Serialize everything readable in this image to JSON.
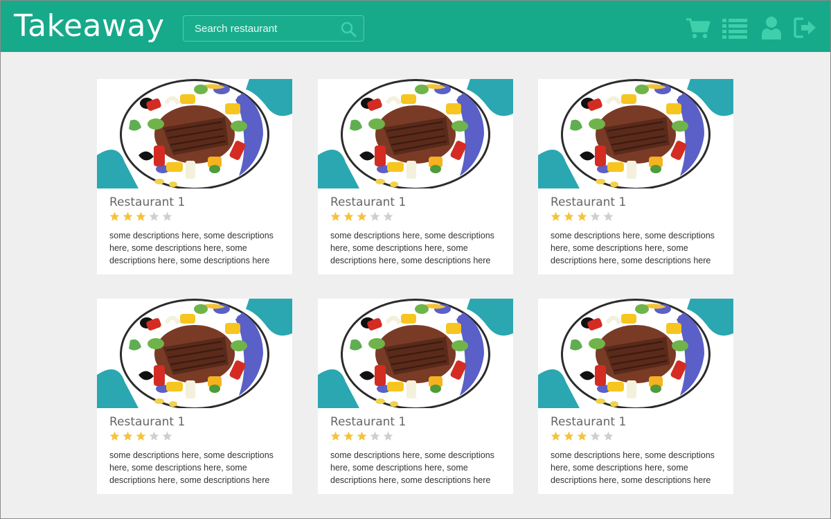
{
  "app": {
    "title": "Takeaway"
  },
  "search": {
    "placeholder": "Search restaurant"
  },
  "nav": {
    "icons": [
      "cart-icon",
      "list-icon",
      "user-icon",
      "logout-icon"
    ]
  },
  "colors": {
    "brand": "#16a98a",
    "icon": "#3fcfab",
    "star_filled": "#f5c33b",
    "star_empty": "#cfcfcf",
    "background": "#efefef"
  },
  "restaurants": [
    {
      "name": "Restaurant 1",
      "rating": 3,
      "max_rating": 5,
      "description": "some descriptions here, some descriptions here, some descriptions here, some descriptions here, some descriptions here"
    },
    {
      "name": "Restaurant 1",
      "rating": 3,
      "max_rating": 5,
      "description": "some descriptions here, some descriptions here, some descriptions here, some descriptions here, some descriptions here"
    },
    {
      "name": "Restaurant 1",
      "rating": 3,
      "max_rating": 5,
      "description": "some descriptions here, some descriptions here, some descriptions here, some descriptions here, some descriptions here"
    },
    {
      "name": "Restaurant 1",
      "rating": 3,
      "max_rating": 5,
      "description": "some descriptions here, some descriptions here, some descriptions here, some descriptions here, some descriptions here"
    },
    {
      "name": "Restaurant 1",
      "rating": 3,
      "max_rating": 5,
      "description": "some descriptions here, some descriptions here, some descriptions here, some descriptions here, some descriptions here"
    },
    {
      "name": "Restaurant 1",
      "rating": 3,
      "max_rating": 5,
      "description": "some descriptions here, some descriptions here, some descriptions here, some descriptions here, some descriptions here"
    }
  ]
}
